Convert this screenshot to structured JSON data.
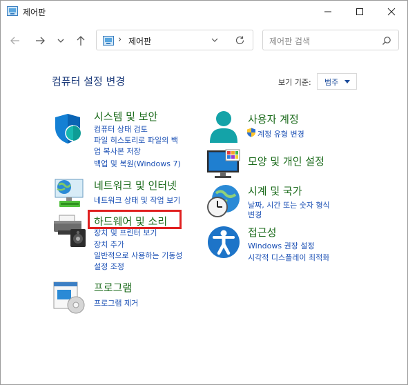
{
  "window": {
    "title": "제어판"
  },
  "address": {
    "path": "제어판"
  },
  "search": {
    "placeholder": "제어판 검색"
  },
  "content": {
    "heading": "컴퓨터 설정 변경",
    "view_by_label": "보기 기준:",
    "view_by_value": "범주"
  },
  "categories": {
    "system": {
      "title": "시스템 및 보안",
      "links": [
        "컴퓨터 상태 검토",
        "파일 히스토리로 파일의 백",
        "업 복사본 저장",
        "백업 및 복원(Windows 7)"
      ]
    },
    "network": {
      "title": "네트워크 및 인터넷",
      "links": [
        "네트워크 상태 및 작업 보기"
      ]
    },
    "hardware": {
      "title": "하드웨어 및 소리",
      "links": [
        "장치 및 프린터 보기",
        "장치 추가",
        "일반적으로 사용하는 기동성",
        "설정 조정"
      ]
    },
    "programs": {
      "title": "프로그램",
      "links": [
        "프로그램 제거"
      ]
    },
    "accounts": {
      "title": "사용자 계정",
      "links": [
        "계정 유형 변경"
      ]
    },
    "appearance": {
      "title": "모양 및 개인 설정",
      "links": []
    },
    "clock": {
      "title": "시계 및 국가",
      "links": [
        "날짜, 시간 또는 숫자 형식",
        "변경"
      ]
    },
    "ease": {
      "title": "접근성",
      "links": [
        "Windows 권장 설정",
        "시각적 디스플레이 최적화"
      ]
    }
  },
  "colors": {
    "category_title": "#1a6a1a",
    "link": "#1a4fb4",
    "heading": "#1b3a7a",
    "highlight_border": "#e02020"
  },
  "icons": [
    "control-panel-icon",
    "minimize-icon",
    "maximize-icon",
    "close-icon",
    "back-arrow-icon",
    "forward-arrow-icon",
    "chevron-down-icon",
    "up-arrow-icon",
    "refresh-icon",
    "search-icon",
    "shield-icon",
    "network-icon",
    "printer-icon",
    "programs-icon",
    "user-icon",
    "uac-shield-icon",
    "monitor-icon",
    "clock-globe-icon",
    "accessibility-icon"
  ]
}
